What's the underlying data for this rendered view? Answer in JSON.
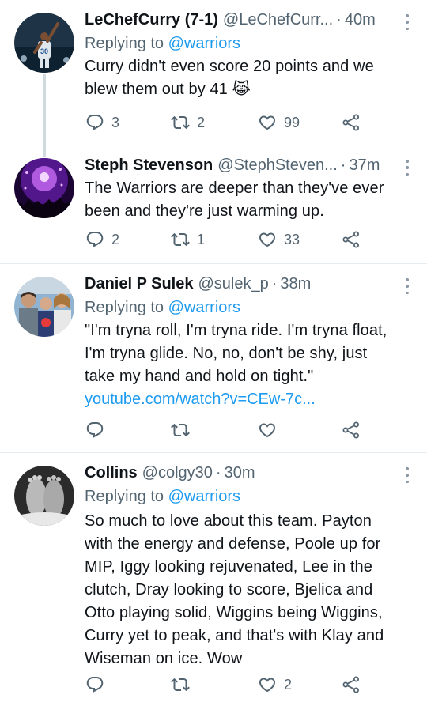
{
  "tweets": [
    {
      "name": "LeChefCurry (7-1)",
      "handle": "@LeChefCurr...",
      "time": "40m",
      "replying_prefix": "Replying to",
      "replying_to": "@warriors",
      "text_lines": [
        "Curry didn't even score 20 points and we",
        "blew them out by 41 😹"
      ],
      "link": "",
      "replies": "3",
      "retweets": "2",
      "likes": "99"
    },
    {
      "name": "Steph Stevenson",
      "handle": "@StephSteven...",
      "time": "37m",
      "replying_prefix": "",
      "replying_to": "",
      "text_lines": [
        "The Warriors are deeper than they've ever",
        "been and they're just warming up."
      ],
      "link": "",
      "replies": "2",
      "retweets": "1",
      "likes": "33"
    },
    {
      "name": "Daniel P Sulek",
      "handle": "@sulek_p",
      "time": "38m",
      "replying_prefix": "Replying to",
      "replying_to": "@warriors",
      "text_lines": [
        "\"I'm tryna roll, I'm tryna ride. I'm tryna float,",
        "I'm tryna glide. No, no, don't be shy, just",
        "take my hand and hold on tight.\""
      ],
      "link": "youtube.com/watch?v=CEw-7c...",
      "replies": "",
      "retweets": "",
      "likes": ""
    },
    {
      "name": "Collins",
      "handle": "@colgy30",
      "time": "30m",
      "replying_prefix": "Replying to",
      "replying_to": "@warriors",
      "text_lines": [
        "So much to love about this team. Payton",
        "with the energy and defense, Poole up for",
        "MIP, Iggy looking rejuvenated, Lee in the",
        "clutch, Dray looking to score, Bjelica and",
        "Otto playing solid, Wiggins being Wiggins,",
        "Curry yet to peak, and that's with Klay and",
        "Wiseman on ice. Wow"
      ],
      "link": "",
      "replies": "",
      "retweets": "",
      "likes": "2"
    }
  ],
  "time_separator": "·",
  "colors": {
    "accent": "#1d9bf0",
    "secondary_text": "#536471",
    "divider": "#e6ecf0"
  }
}
